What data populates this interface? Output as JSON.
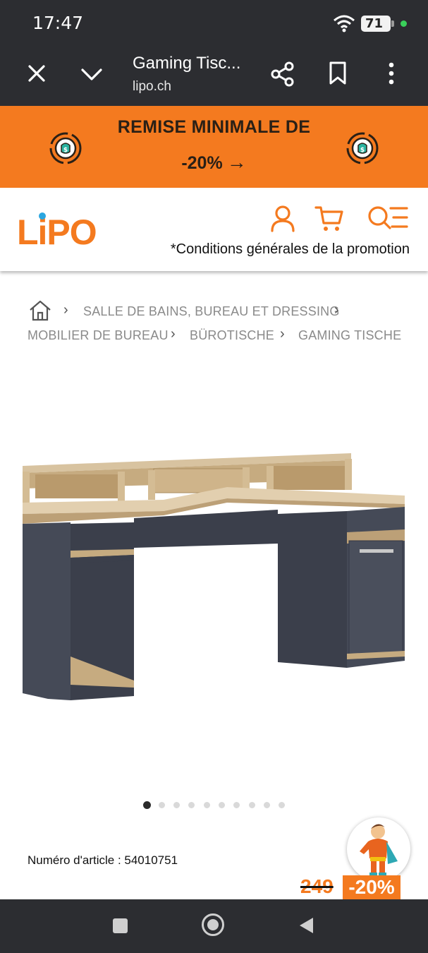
{
  "status_bar": {
    "time": "17:47",
    "battery": "71"
  },
  "browser": {
    "title": "Gaming Tisc...",
    "url": "lipo.ch"
  },
  "promo": {
    "line1": "REMISE MINIMALE DE",
    "line2": "-20%",
    "arrow": "→"
  },
  "header": {
    "logo": "LiPO",
    "conditions": "*Conditions générales de la promotion"
  },
  "breadcrumb": {
    "items": [
      "SALLE DE BAINS, BUREAU ET DRESSING",
      "MOBILIER DE BUREAU",
      "BÜROTISCHE",
      "GAMING TISCHE"
    ],
    "separator": "›"
  },
  "product": {
    "article_number": "Numéro d'article : 54010751",
    "old_price": "249",
    "discount": "-20%",
    "image_count": 10,
    "active_image": 1
  },
  "colors": {
    "brand_orange": "#f47a1f",
    "chrome_dark": "#2c2d31"
  },
  "icons": [
    "close-icon",
    "chevron-down-icon",
    "share-icon",
    "bookmark-icon",
    "more-icon",
    "coin-icon",
    "user-icon",
    "cart-icon",
    "menu-search-icon",
    "home-icon",
    "mascot-icon"
  ]
}
